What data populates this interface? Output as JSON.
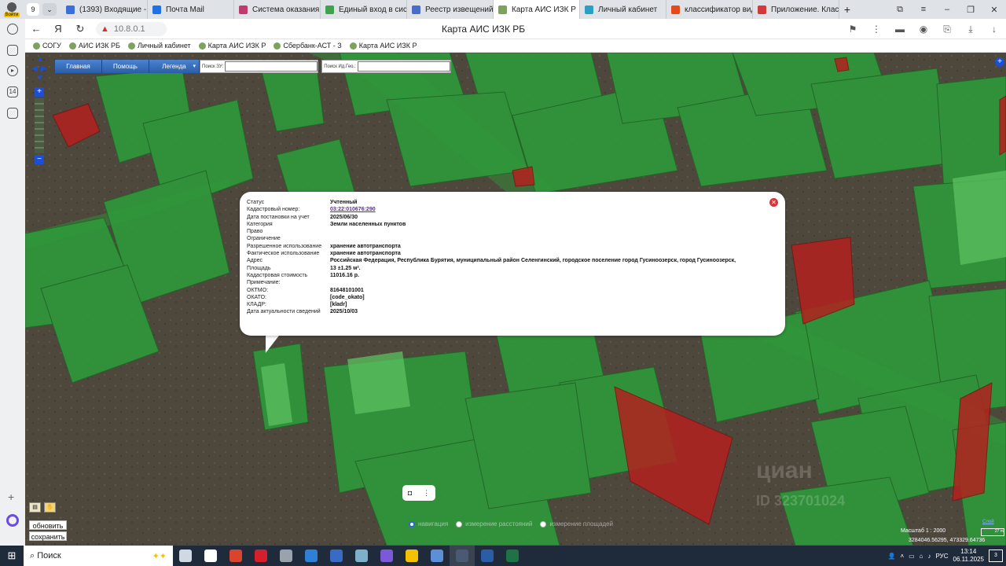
{
  "browser": {
    "profile_label": "Войти",
    "tab_count": "9",
    "tabs": [
      {
        "label": "(1393) Входящие - П",
        "color": "#3b6fd9",
        "active": false
      },
      {
        "label": "Почта Mail",
        "color": "#1e72e6",
        "active": false
      },
      {
        "label": "Система оказания г",
        "color": "#c03a6e",
        "active": false
      },
      {
        "label": "Единый вход в сист",
        "color": "#3fa34d",
        "active": false
      },
      {
        "label": "Реестр извещений",
        "color": "#4a6cc9",
        "active": false
      },
      {
        "label": "Карта АИС ИЗК Р",
        "color": "#7da15f",
        "active": true
      },
      {
        "label": "Личный кабинет",
        "color": "#2aa0c2",
        "active": false
      },
      {
        "label": "классификатор вид",
        "color": "#e64a19",
        "active": false
      },
      {
        "label": "Приложение. Класс",
        "color": "#d23a3a",
        "active": false
      }
    ],
    "address": "10.8.0.1",
    "page_title": "Карта АИС ИЗК РБ",
    "bookmarks": [
      "СОГУ",
      "АИС ИЗК РБ",
      "Личный кабинет",
      "Карта АИС ИЗК Р",
      "Сбербанк-АСТ - З",
      "Карта АИС ИЗК Р"
    ]
  },
  "sidebar": {
    "badge": "14"
  },
  "map_toolbar": {
    "home": "Главная",
    "help": "Помощь",
    "legend": "Легенда",
    "search_zu_label": "Поиск ЗУ:",
    "search_zu_value": "",
    "search_id_label": "Поиск Ид.Гео.:",
    "search_id_value": ""
  },
  "popup": {
    "rows": [
      {
        "k": "Статус",
        "v": "Учтенный"
      },
      {
        "k": "Кадастровый номер:",
        "v": "03:22:010676:290",
        "link": true
      },
      {
        "k": "Дата постановки на учет",
        "v": "2025/06/30"
      },
      {
        "k": "Категория",
        "v": "Земли населенных пунктов"
      },
      {
        "k": "Право",
        "v": ""
      },
      {
        "k": "Ограничение",
        "v": ""
      },
      {
        "k": "Разрешенное использование",
        "v": "хранение автотранспорта"
      },
      {
        "k": "Фактическое использование",
        "v": "хранение автотранспорта"
      },
      {
        "k": "Адрес",
        "v": "Российская Федерация, Республика Бурятия, муниципальный район Селенгинский, городское поселение город Гусиноозерск, город Гусиноозерск,"
      },
      {
        "k": "Площадь",
        "v": "13 ±1.25 м²."
      },
      {
        "k": "Кадастровая стоимость",
        "v": "11016.16 р."
      },
      {
        "k": "Примечание:",
        "v": ""
      },
      {
        "k": "ОКТМО:",
        "v": "81648101001"
      },
      {
        "k": "ОКАТО:",
        "v": "[code_okato]"
      },
      {
        "k": "КЛАДР:",
        "v": "[kladr]"
      },
      {
        "k": "Дата актуальности сведений",
        "v": "2025/10/03"
      }
    ]
  },
  "map_controls": {
    "mode_navigation": "навигация",
    "mode_distance": "измерение расстояний",
    "mode_area": "измерение площадей",
    "refresh": "обновить",
    "save": "сохранить",
    "scale": "Масштаб 1 : 2000",
    "scale_bar": "27 m",
    "coords": "3284046.56295, 473329.64736",
    "right_link": "Слой",
    "watermark": "циан",
    "watermark_id": "ID 323701024"
  },
  "taskbar": {
    "search_placeholder": "Поиск",
    "lang": "РУС",
    "time": "13:14",
    "date": "06.11.2025",
    "notifications": "3",
    "apps": [
      {
        "name": "task-view",
        "color": "#cfd8e3"
      },
      {
        "name": "chrome",
        "color": "#ffffff"
      },
      {
        "name": "pdf",
        "color": "#d9442f"
      },
      {
        "name": "app-red",
        "color": "#d61f2b"
      },
      {
        "name": "app-gray",
        "color": "#9aa3ad"
      },
      {
        "name": "screen",
        "color": "#2f7fd6"
      },
      {
        "name": "paint",
        "color": "#3a6bc4"
      },
      {
        "name": "wheel",
        "color": "#7fb0c9"
      },
      {
        "name": "viber",
        "color": "#7a5ad8"
      },
      {
        "name": "files",
        "color": "#f2c200"
      },
      {
        "name": "installer",
        "color": "#5c8fd6"
      },
      {
        "name": "yandex",
        "color": "#4b5a73"
      },
      {
        "name": "word",
        "color": "#2b5ca8"
      },
      {
        "name": "excel",
        "color": "#1f7244"
      }
    ]
  }
}
